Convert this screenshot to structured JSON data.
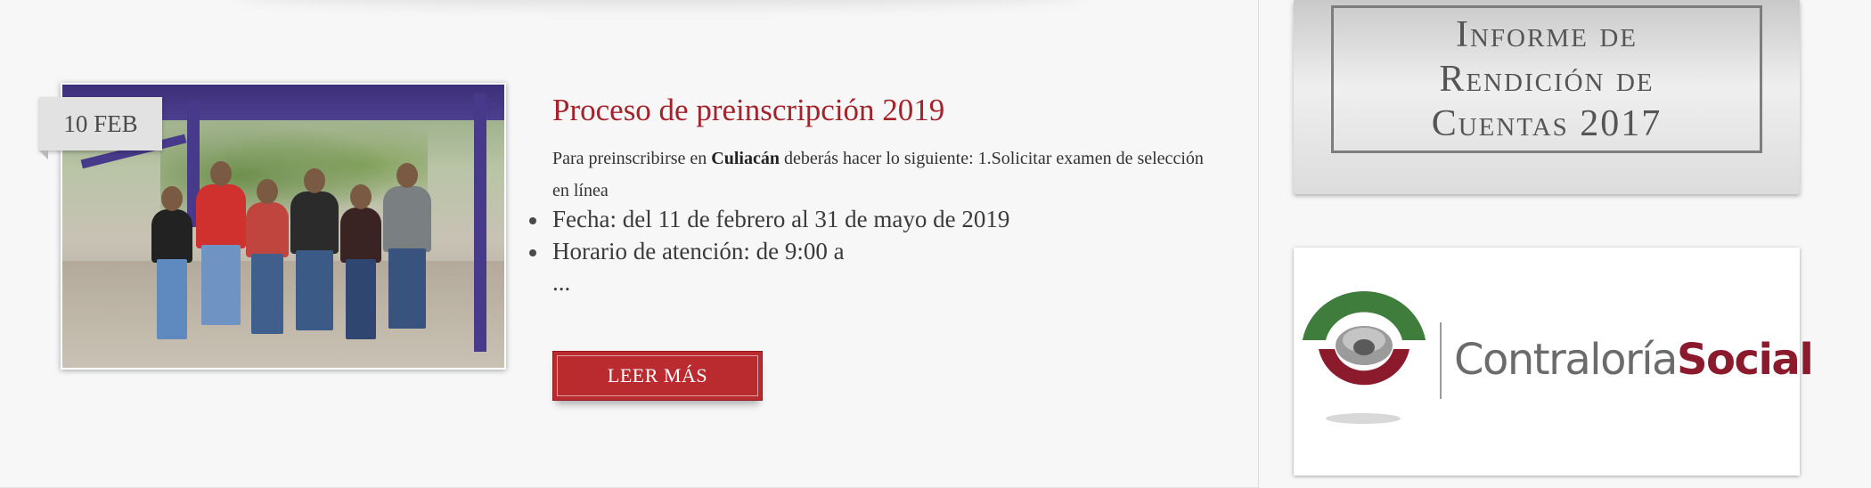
{
  "post": {
    "date_badge": "10 FEB",
    "title": "Proceso de preinscripción 2019",
    "excerpt_prefix": "Para preinscribirse en ",
    "excerpt_bold": "Culiacán",
    "excerpt_suffix": " deberás hacer lo siguiente: 1.Solicitar examen de selección en línea",
    "list_items": [
      "Fecha: del 11 de febrero al 31 de mayo de 2019",
      "Horario de atención: de 9:00 a"
    ],
    "ellipsis": "...",
    "read_more_label": "LEER MÁS"
  },
  "sidebar": {
    "banner_informe": {
      "line1": "Informe de",
      "line2": "Rendición de",
      "line3": "Cuentas 2017"
    },
    "banner_contraloria": {
      "brand_plain": "Contraloría",
      "brand_accent": "Social"
    }
  },
  "colors": {
    "title_red": "#a4232a",
    "button_red": "#b92b2e",
    "logo_green": "#3c7a3a",
    "logo_maroon": "#8b1a2c"
  }
}
